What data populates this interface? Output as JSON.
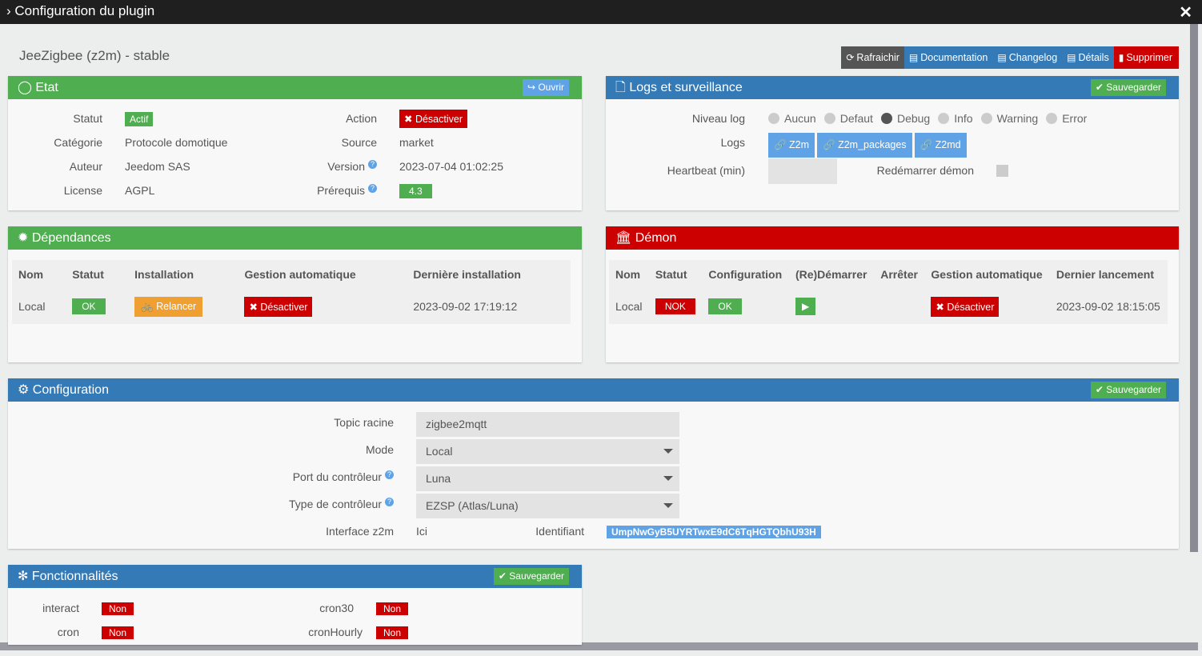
{
  "window": {
    "title": "Configuration du plugin"
  },
  "plugin_name": "JeeZigbee (z2m) - stable",
  "toolbar": {
    "refresh": "Rafraichir",
    "documentation": "Documentation",
    "changelog": "Changelog",
    "details": "Détails",
    "delete": "Supprimer"
  },
  "etat": {
    "title": "Etat",
    "open": "Ouvrir",
    "statut_l": "Statut",
    "statut": "Actif",
    "categorie_l": "Catégorie",
    "categorie": "Protocole domotique",
    "auteur_l": "Auteur",
    "auteur": "Jeedom SAS",
    "license_l": "License",
    "license": "AGPL",
    "action_l": "Action",
    "action": "Désactiver",
    "source_l": "Source",
    "source": "market",
    "version_l": "Version",
    "version": "2023-07-04 01:02:25",
    "prerequis_l": "Prérequis",
    "prerequis": "4.3"
  },
  "logs": {
    "title": "Logs et surveillance",
    "save": "Sauvegarder",
    "niveau_l": "Niveau log",
    "levels": [
      "Aucun",
      "Defaut",
      "Debug",
      "Info",
      "Warning",
      "Error"
    ],
    "selected": "Debug",
    "logs_l": "Logs",
    "log_buttons": [
      "Z2m",
      "Z2m_packages",
      "Z2md"
    ],
    "heartbeat_l": "Heartbeat (min)",
    "heartbeat": "",
    "restart_l": "Redémarrer démon"
  },
  "deps": {
    "title": "Dépendances",
    "headers": [
      "Nom",
      "Statut",
      "Installation",
      "Gestion automatique",
      "Dernière installation"
    ],
    "row": {
      "nom": "Local",
      "statut": "OK",
      "installation": "Relancer",
      "gestion": "Désactiver",
      "date": "2023-09-02 17:19:12"
    }
  },
  "demon": {
    "title": "Démon",
    "headers": [
      "Nom",
      "Statut",
      "Configuration",
      "(Re)Démarrer",
      "Arrêter",
      "Gestion automatique",
      "Dernier lancement"
    ],
    "row": {
      "nom": "Local",
      "statut": "NOK",
      "config": "OK",
      "gestion": "Désactiver",
      "date": "2023-09-02 18:15:05"
    }
  },
  "config": {
    "title": "Configuration",
    "save": "Sauvegarder",
    "topic_l": "Topic racine",
    "topic": "zigbee2mqtt",
    "mode_l": "Mode",
    "mode": "Local",
    "port_l": "Port du contrôleur",
    "port": "Luna",
    "type_l": "Type de contrôleur",
    "type": "EZSP (Atlas/Luna)",
    "iface_l": "Interface z2m",
    "iface": "Ici",
    "id_l": "Identifiant",
    "id": "UmpNwGyB5UYRTwxE9dC6TqHGTQbhU93H"
  },
  "fonct": {
    "title": "Fonctionnalités",
    "save": "Sauvegarder",
    "items": [
      {
        "label": "interact",
        "value": "Non"
      },
      {
        "label": "cron30",
        "value": "Non"
      },
      {
        "label": "cron",
        "value": "Non"
      },
      {
        "label": "cronHourly",
        "value": "Non"
      }
    ]
  }
}
